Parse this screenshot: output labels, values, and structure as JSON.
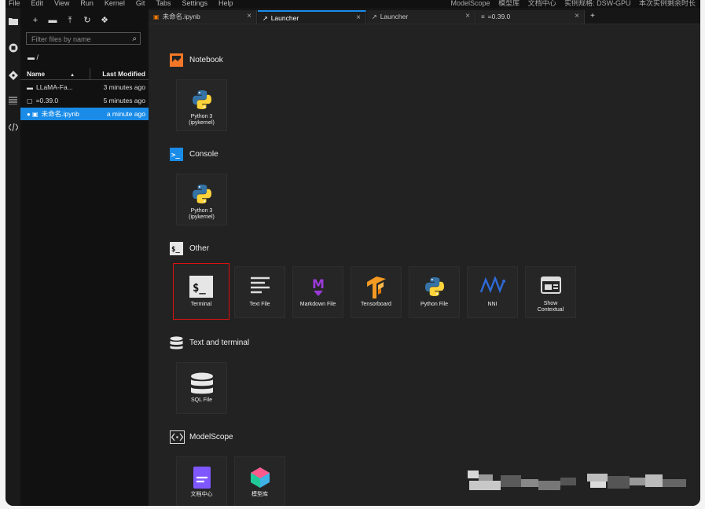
{
  "menubar": {
    "items": [
      "File",
      "Edit",
      "View",
      "Run",
      "Kernel",
      "Git",
      "Tabs",
      "Settings",
      "Help"
    ],
    "brand": "ModelScope",
    "right_links": [
      "模型库",
      "文档中心",
      "实例规格: DSW-GPU",
      "本次实例剩余时长"
    ]
  },
  "activity_bar": {
    "icons": [
      "folder-icon",
      "running-icon",
      "git-icon",
      "toc-icon",
      "extension-icon"
    ]
  },
  "file_browser": {
    "toolbar": [
      "new-launcher-icon",
      "new-folder-icon",
      "upload-icon",
      "refresh-icon",
      "git-clone-icon"
    ],
    "toolbar_glyphs": [
      "+",
      "▬",
      "⤒",
      "↻",
      "❖"
    ],
    "filter_placeholder": "Filter files by name",
    "breadcrumb": "▬ /",
    "columns": {
      "name": "Name",
      "sort_arrow": "▲",
      "modified": "Last Modified"
    },
    "files": [
      {
        "icon": "folder-icon",
        "glyph": "▬",
        "name": "LLaMA-Fa...",
        "modified": "3 minutes ago",
        "selected": false
      },
      {
        "icon": "file-icon",
        "glyph": "▢",
        "name": "=0.39.0",
        "modified": "5 minutes ago",
        "selected": false
      },
      {
        "icon": "notebook-icon",
        "glyph": "● ▣",
        "name": "未命名.ipynb",
        "modified": "a minute ago",
        "selected": true
      }
    ]
  },
  "tabs": [
    {
      "label": "未命名.ipynb",
      "icon": "notebook-icon",
      "glyph": "▣",
      "active": false
    },
    {
      "label": "Launcher",
      "icon": "launcher-icon",
      "glyph": "↗",
      "active": true
    },
    {
      "label": "Launcher",
      "icon": "launcher-icon",
      "glyph": "↗",
      "active": false
    },
    {
      "label": "=0.39.0",
      "icon": "text-file-icon",
      "glyph": "≡",
      "active": false
    }
  ],
  "tab_close_glyph": "×",
  "tab_add_glyph": "+",
  "sections": [
    {
      "title": "Notebook",
      "icon": "notebook-section-icon",
      "cards": [
        {
          "label": "Python 3\n(ipykernel)",
          "icon": "python-icon"
        }
      ]
    },
    {
      "title": "Console",
      "icon": "console-section-icon",
      "glyph": ">_",
      "cards": [
        {
          "label": "Python 3\n(ipykernel)",
          "icon": "python-icon"
        }
      ]
    },
    {
      "title": "Other",
      "icon": "other-section-icon",
      "glyph": "$_",
      "cards": [
        {
          "label": "Terminal",
          "icon": "terminal-icon",
          "glyph": "$_",
          "highlighted": true
        },
        {
          "label": "Text File",
          "icon": "text-file-icon"
        },
        {
          "label": "Markdown File",
          "icon": "markdown-icon",
          "glyph": "M"
        },
        {
          "label": "Tensorboard",
          "icon": "tensorboard-icon"
        },
        {
          "label": "Python File",
          "icon": "python-icon"
        },
        {
          "label": "NNI",
          "icon": "nni-icon",
          "glyph": "ꟿ"
        },
        {
          "label": "Show\nContextual",
          "icon": "contextual-help-icon"
        }
      ]
    },
    {
      "title": "Text and terminal",
      "icon": "database-section-icon",
      "cards": [
        {
          "label": "SQL File",
          "icon": "database-icon"
        }
      ]
    },
    {
      "title": "ModelScope",
      "icon": "modelscope-section-icon",
      "glyph": "<·>",
      "cards": [
        {
          "label": "文档中心",
          "icon": "docs-icon"
        },
        {
          "label": "模型库",
          "icon": "model-library-icon"
        }
      ]
    }
  ],
  "colors": {
    "accent": "#1a8ce8",
    "highlight_border": "#dd1111",
    "python_blue": "#3572a5",
    "python_yellow": "#ffd43b",
    "markdown_purple": "#9b3ad8",
    "tensorboard_orange": "#f59a22",
    "nni_blue": "#2e6bd8"
  }
}
